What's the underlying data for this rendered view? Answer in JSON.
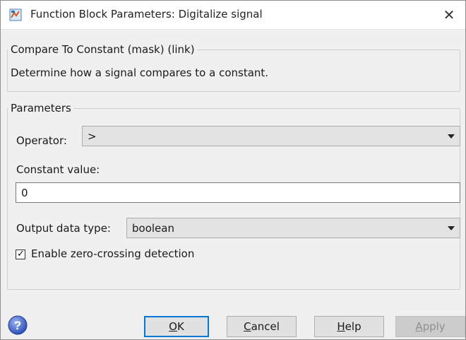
{
  "window": {
    "title": "Function Block Parameters: Digitalize signal",
    "close_glyph": "✕"
  },
  "description": {
    "legend": "Compare To Constant (mask) (link)",
    "text": "Determine how a signal compares to a constant."
  },
  "parameters": {
    "legend": "Parameters",
    "operator_label": "Operator:",
    "operator_value": ">",
    "constant_label": "Constant value:",
    "constant_value": "0",
    "output_type_label": "Output data type:",
    "output_type_value": "boolean",
    "zero_crossing_label": "Enable zero-crossing detection",
    "zero_crossing_checked": true
  },
  "buttons": {
    "ok_key": "O",
    "ok_rest": "K",
    "cancel_key": "C",
    "cancel_rest": "ancel",
    "help_key": "H",
    "help_rest": "elp",
    "apply_key": "A",
    "apply_rest": "pply"
  },
  "icons": {
    "app": "simulink-block-icon",
    "help": "help-question-icon",
    "dropdown": "chevron-down-icon",
    "check": "checkmark-icon"
  },
  "colors": {
    "accent": "#0078d7",
    "disabled_text": "#8f8f8f"
  }
}
